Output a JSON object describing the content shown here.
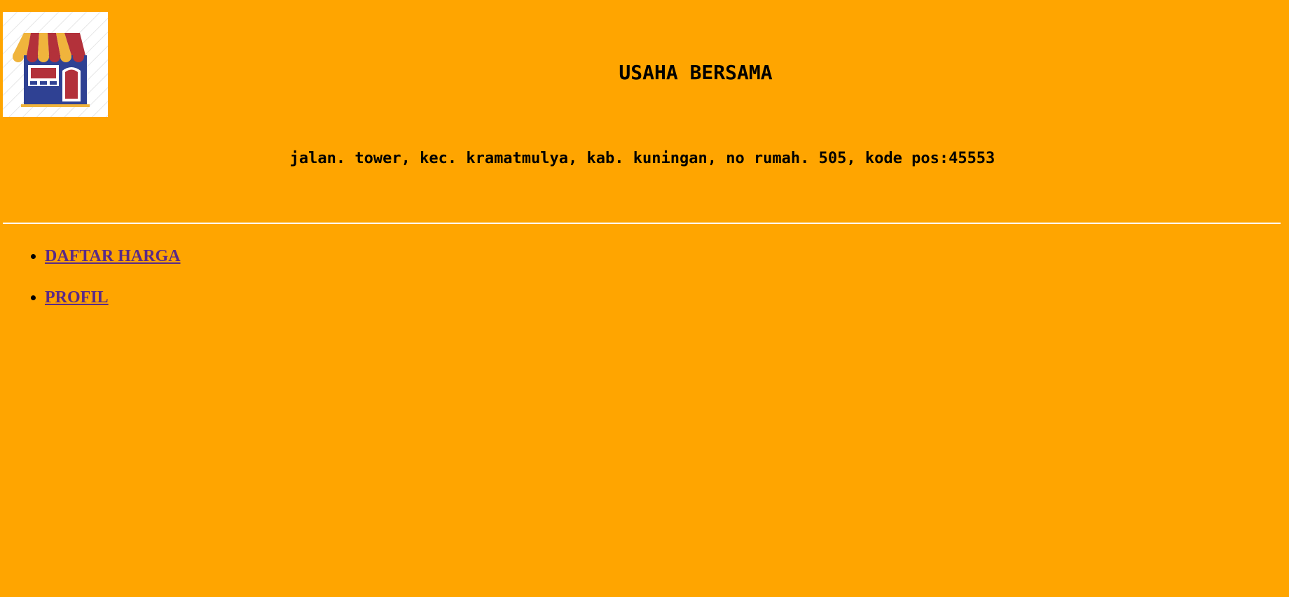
{
  "header": {
    "logo_icon": "storefront-icon",
    "title": "USAHA BERSAMA",
    "address": "jalan. tower, kec. kramatmulya, kab. kuningan, no rumah. 505, kode pos:45553"
  },
  "nav": {
    "items": [
      {
        "label": "DAFTAR HARGA"
      },
      {
        "label": "PROFIL"
      }
    ]
  },
  "colors": {
    "background": "#ffa500",
    "link": "#5b2a86",
    "text": "#000000",
    "rule": "#ffffff"
  }
}
